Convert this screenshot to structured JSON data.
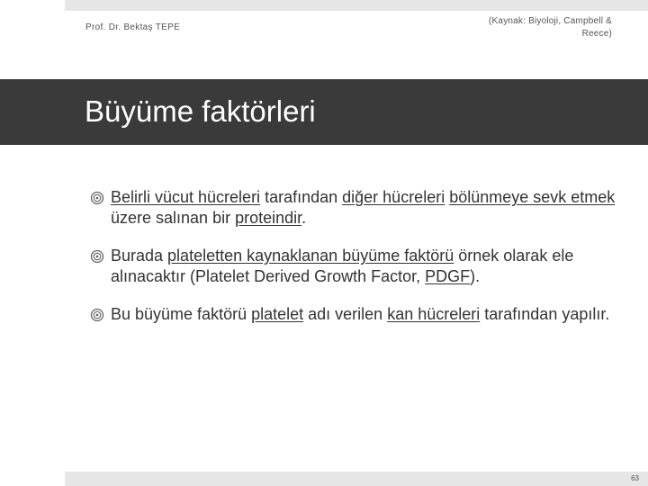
{
  "header": {
    "author": "Prof. Dr. Bektaş TEPE",
    "source_line1": "(Kaynak: Biyoloji, Campbell &",
    "source_line2": "Reece)"
  },
  "slide": {
    "title": "Büyüme faktörleri"
  },
  "bullets": [
    {
      "icon": "target-bullet-icon",
      "segments": [
        {
          "text": "Belirli vücut hücreleri",
          "underline": true
        },
        {
          "text": " tarafından ",
          "underline": false
        },
        {
          "text": "diğer hücreleri",
          "underline": true
        },
        {
          "text": " ",
          "underline": false
        },
        {
          "text": "bölünmeye sevk etmek",
          "underline": true
        },
        {
          "text": " üzere salınan bir ",
          "underline": false
        },
        {
          "text": "proteindir",
          "underline": true
        },
        {
          "text": ".",
          "underline": false
        }
      ]
    },
    {
      "icon": "target-bullet-icon",
      "segments": [
        {
          "text": "Burada ",
          "underline": false
        },
        {
          "text": "plateletten kaynaklanan büyüme faktörü",
          "underline": true
        },
        {
          "text": " örnek olarak ele alınacaktır (Platelet Derived Growth Factor, ",
          "underline": false
        },
        {
          "text": "PDGF",
          "underline": true
        },
        {
          "text": ").",
          "underline": false
        }
      ]
    },
    {
      "icon": "target-bullet-icon",
      "segments": [
        {
          "text": "Bu büyüme faktörü ",
          "underline": false
        },
        {
          "text": "platelet",
          "underline": true
        },
        {
          "text": " adı verilen ",
          "underline": false
        },
        {
          "text": "kan hücreleri",
          "underline": true
        },
        {
          "text": " tarafından yapılır.",
          "underline": false
        }
      ]
    }
  ],
  "footer": {
    "page_number": "63"
  }
}
